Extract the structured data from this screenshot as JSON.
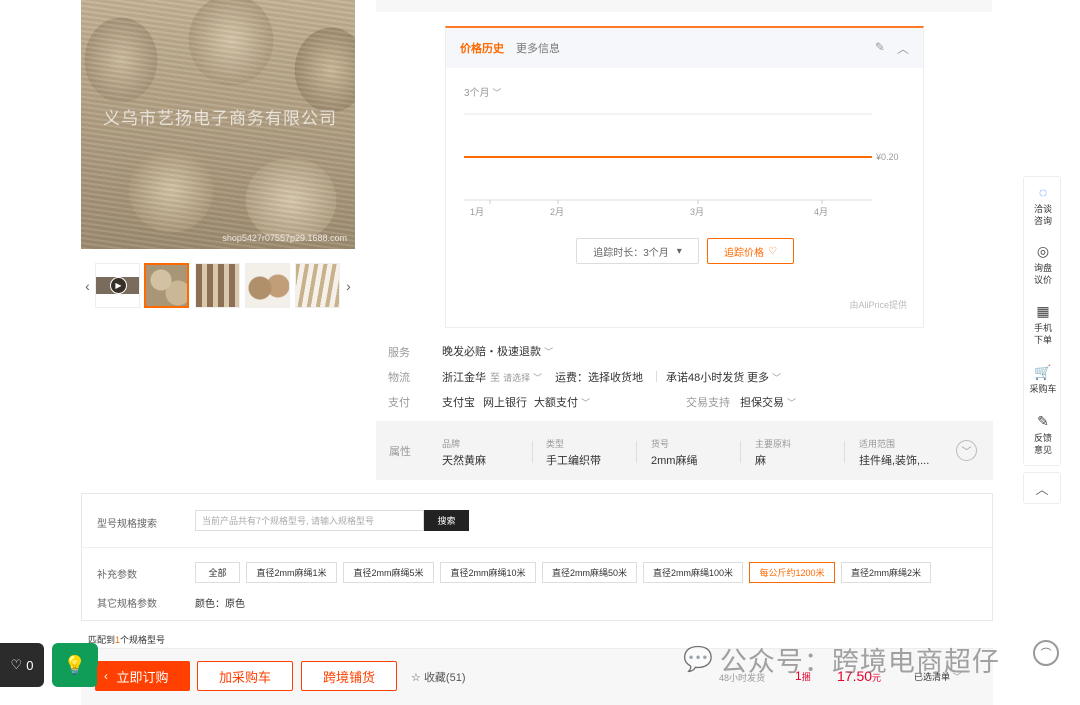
{
  "gallery": {
    "watermark": "义乌市艺扬电子商务有限公司",
    "shop_mark": "shop5427r07557p29.1688.com"
  },
  "price_history": {
    "tab_active": "价格历史",
    "tab_more": "更多信息",
    "range": "3个月",
    "track_duration": "追踪时长：3个月",
    "follow_price": "追踪价格",
    "provider": "由AliPrice提供"
  },
  "chart_data": {
    "type": "line",
    "x": [
      "1月",
      "2月",
      "3月",
      "4月"
    ],
    "series": [
      {
        "values": [
          0.2,
          0.2,
          0.2,
          0.2
        ]
      }
    ],
    "value_label": "¥0.20"
  },
  "info": {
    "service_label": "服务",
    "service_value": "晚发必赔・极速退款",
    "logistics_label": "物流",
    "from": "浙江金华",
    "to_word": "至",
    "to_select": "请选择",
    "freight": "运费：选择收货地",
    "promise": "承诺48小时发货",
    "more": "更多",
    "pay_label": "支付",
    "pay_methods": [
      "支付宝",
      "网上银行",
      "大额支付"
    ],
    "trade_label": "交易支持",
    "trade_value": "担保交易"
  },
  "attributes": {
    "title": "属性",
    "items": [
      {
        "k": "品牌",
        "v": "天然黄麻"
      },
      {
        "k": "类型",
        "v": "手工编织带"
      },
      {
        "k": "货号",
        "v": "2mm麻绳"
      },
      {
        "k": "主要原料",
        "v": "麻"
      },
      {
        "k": "适用范围",
        "v": "挂件绳,装饰,..."
      }
    ]
  },
  "spec": {
    "search_label": "型号规格搜索",
    "search_placeholder": "当前产品共有7个规格型号, 请输入规格型号",
    "search_button": "搜索",
    "extra_label": "补充参数",
    "options": [
      "全部",
      "直径2mm麻绳1米",
      "直径2mm麻绳5米",
      "直径2mm麻绳10米",
      "直径2mm麻绳50米",
      "直径2mm麻绳100米",
      "每公斤约1200米",
      "直径2mm麻绳2米"
    ],
    "other_label": "其它规格参数",
    "other_value": "颜色：原色",
    "match_prefix": "匹配到",
    "match_count": "1",
    "match_suffix": "个规格型号"
  },
  "bottom": {
    "buy_now": "立即订购",
    "add_cart": "加采购车",
    "cross_border": "跨境铺货",
    "favorites": "收藏(51)",
    "ship_time": "48小时发货",
    "qty": "1",
    "qty_unit": "捆",
    "price": "17.50",
    "price_unit": "元",
    "selected": "已选清单"
  },
  "floating": {
    "likes": "0"
  },
  "sidebar": {
    "items": [
      {
        "label1": "洽谈",
        "label2": "咨询"
      },
      {
        "label1": "询盘",
        "label2": "议价"
      },
      {
        "label1": "手机",
        "label2": "下单"
      },
      {
        "label1": "采购车",
        "label2": ""
      },
      {
        "label1": "反馈",
        "label2": "意见"
      }
    ]
  },
  "watermark_wx": "公众号：跨境电商超仔",
  "colors": {
    "accent": "#ff6a00",
    "buy": "#ff4000",
    "price": "#e4002b"
  }
}
